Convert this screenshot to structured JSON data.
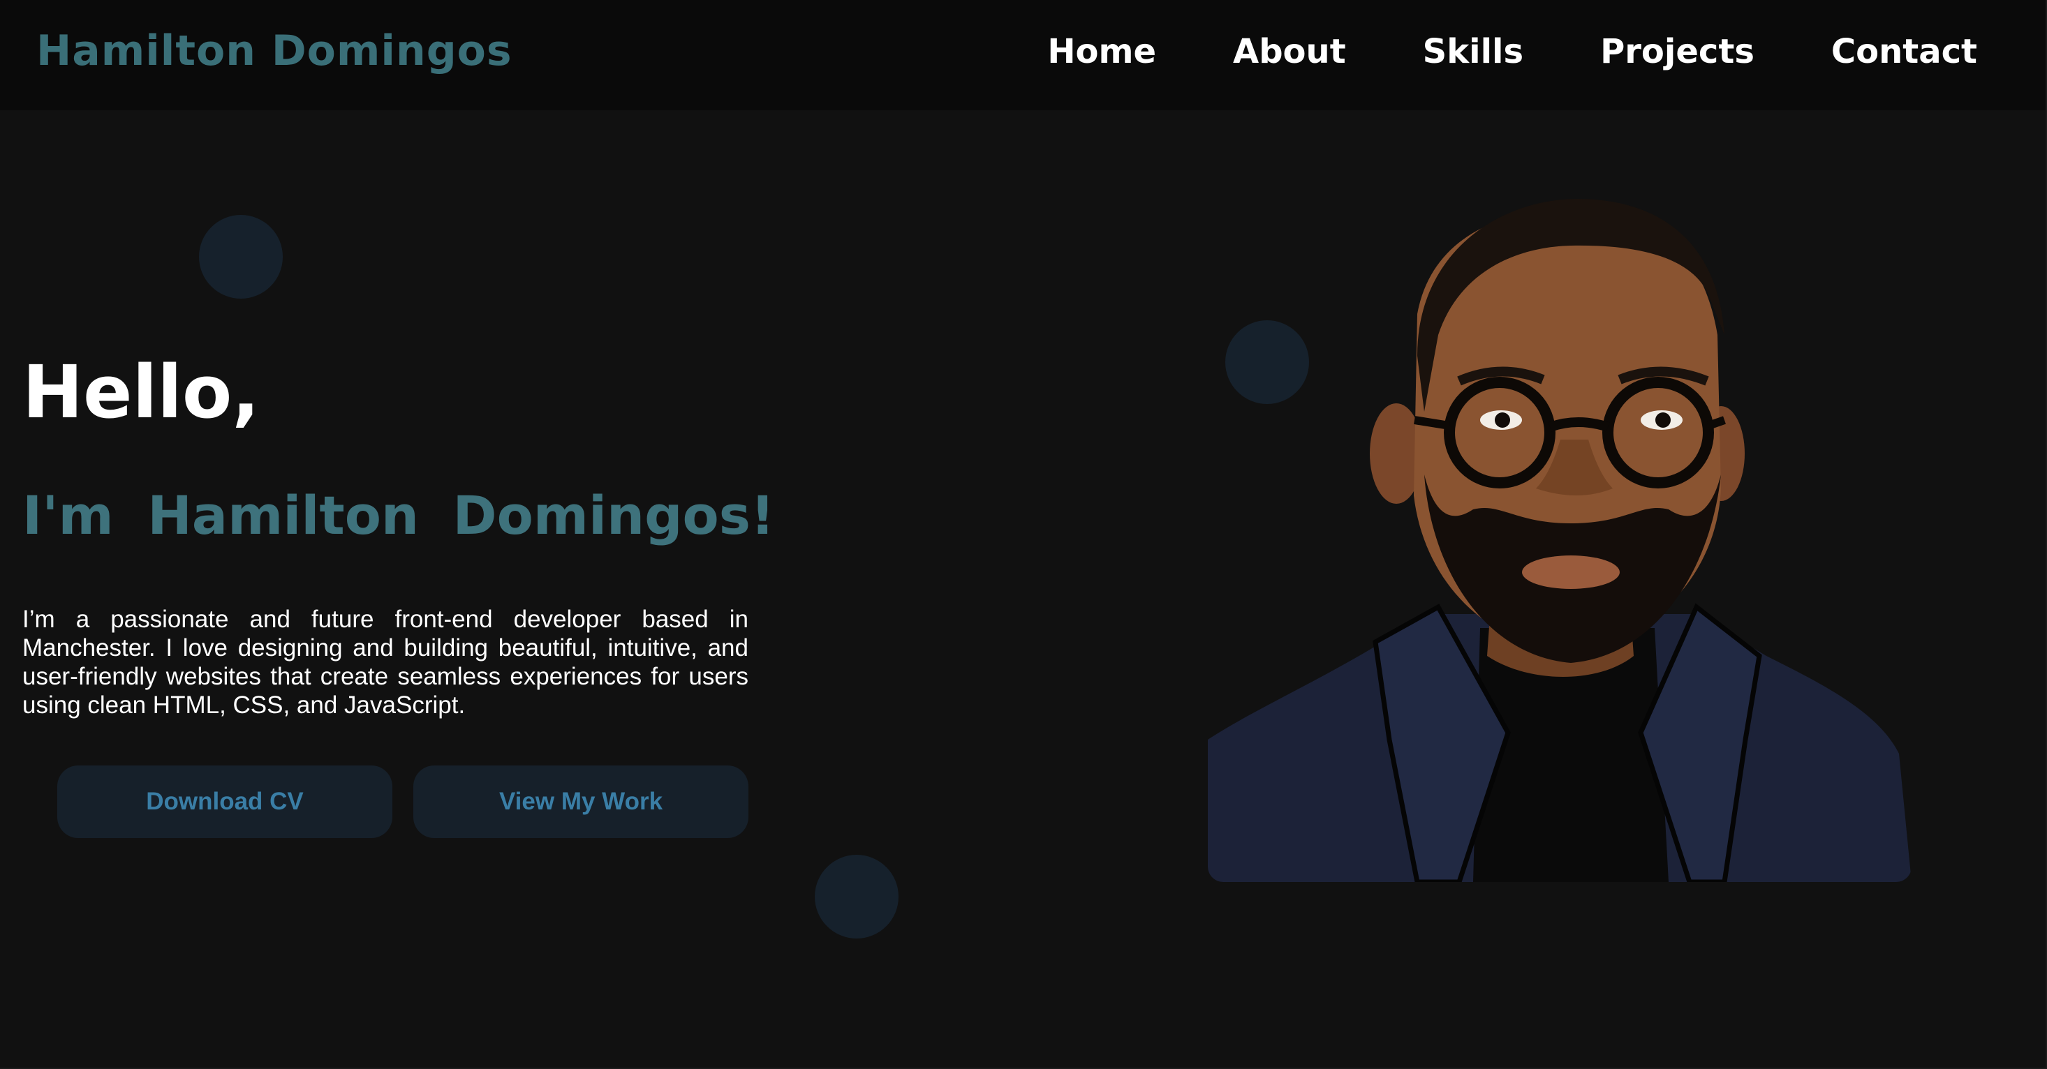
{
  "brand": {
    "name": "Hamilton Domingos"
  },
  "nav": {
    "items": [
      {
        "label": "Home"
      },
      {
        "label": "About"
      },
      {
        "label": "Skills"
      },
      {
        "label": "Projects"
      },
      {
        "label": "Contact"
      }
    ]
  },
  "hero": {
    "greeting": "Hello,",
    "intro": "I'm  Hamilton  Domingos!",
    "bio": "I’m a passionate and future front-end developer based in Manchester. I love designing and building beautiful, intuitive, and user-friendly websites that create seamless experiences for users using clean HTML, CSS, and JavaScript.",
    "buttons": {
      "download_cv": "Download CV",
      "view_work": "View My Work"
    }
  },
  "colors": {
    "background": "#111111",
    "navbar": "#0a0a0a",
    "accent_teal": "#3e727c",
    "button_bg": "#16202a",
    "button_text": "#3a7ea6",
    "decor_dot": "#16212c"
  },
  "illustration": {
    "subject": "portrait-avatar"
  }
}
